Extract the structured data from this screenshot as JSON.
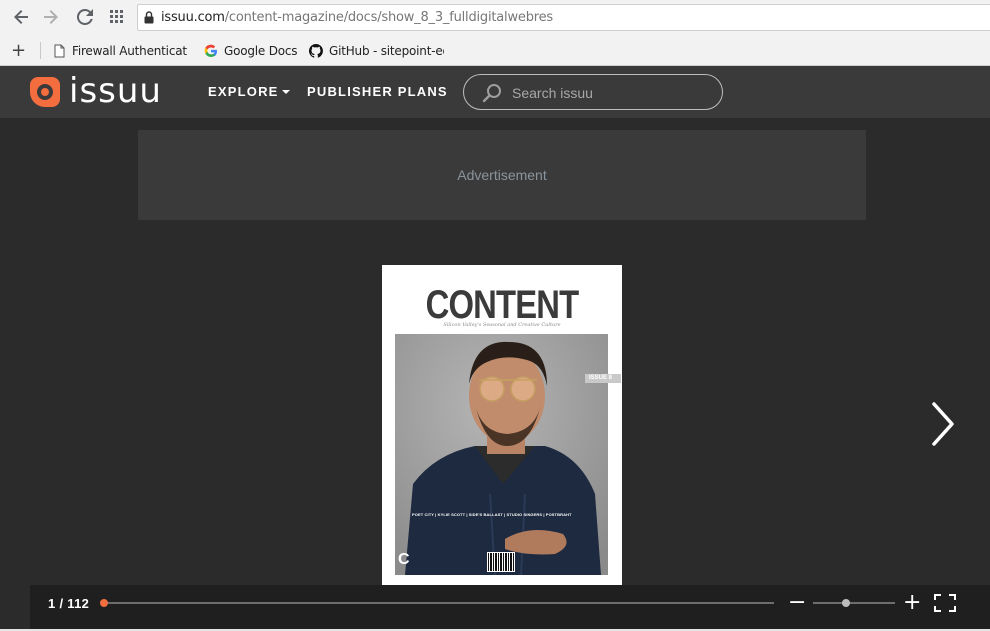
{
  "browser": {
    "url_host": "issuu.com",
    "url_path": "/content-magazine/docs/show_8_3_fulldigitalwebres",
    "bookmarks": [
      {
        "label": "Firewall Authenticatio",
        "icon": "page-icon"
      },
      {
        "label": "Google Docs",
        "icon": "google-icon"
      },
      {
        "label": "GitHub - sitepoint-ed",
        "icon": "github-icon"
      }
    ]
  },
  "header": {
    "logo_text": "issuu",
    "nav": {
      "explore": "EXPLORE",
      "publisher_plans": "PUBLISHER PLANS"
    },
    "search_placeholder": "Search issuu"
  },
  "ad": {
    "label": "Advertisement"
  },
  "document": {
    "cover_title": "CONTENT",
    "cover_subtitle": "Silicon Valley's Seasonal and Creative Culture",
    "issue_tag": "ISSUE 8",
    "cover_line": "POET CITY | KYLIE SCOTT | SIDE'S BALLAST | STUDIO SINGERS | POSTBRAHT",
    "cover_letter": "C"
  },
  "viewer": {
    "current_page": 1,
    "total_pages": 112,
    "page_label": "1 / 112",
    "progress_fraction": 0.0,
    "zoom_fraction": 0.4,
    "accent_color": "#f36d3f"
  }
}
